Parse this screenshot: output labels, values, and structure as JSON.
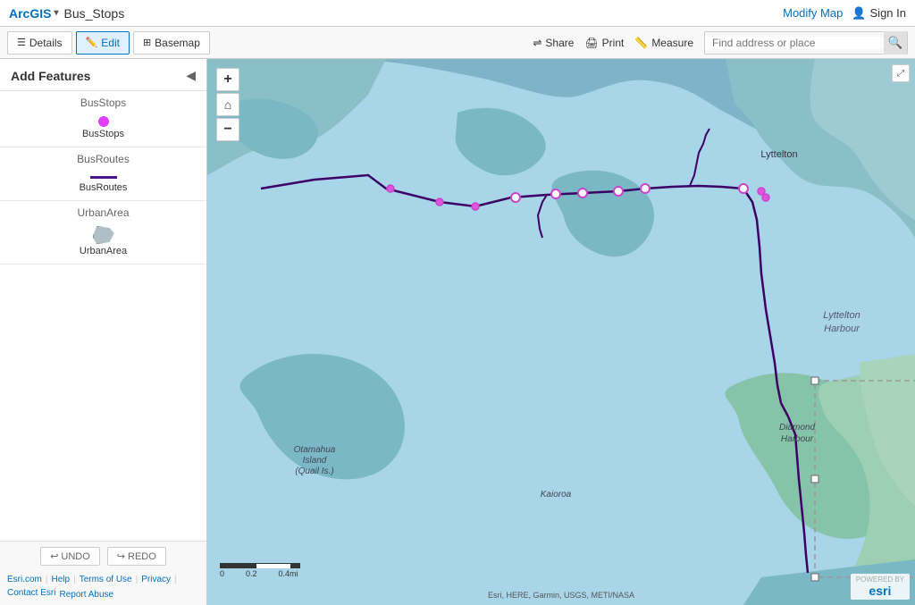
{
  "app": {
    "name": "ArcGIS",
    "map_title": "Bus_Stops"
  },
  "topbar": {
    "modify_map": "Modify Map",
    "sign_in": "Sign In"
  },
  "toolbar": {
    "details_label": "Details",
    "edit_label": "Edit",
    "basemap_label": "Basemap",
    "share_label": "Share",
    "print_label": "Print",
    "measure_label": "Measure",
    "search_placeholder": "Find address or place"
  },
  "sidebar": {
    "title": "Add Features",
    "groups": [
      {
        "label": "BusStops",
        "icon": "dot",
        "item_label": "BusStops"
      },
      {
        "label": "BusRoutes",
        "icon": "line",
        "item_label": "BusRoutes"
      },
      {
        "label": "UrbanArea",
        "icon": "polygon",
        "item_label": "UrbanArea"
      }
    ],
    "undo_label": "UNDO",
    "redo_label": "REDO"
  },
  "footer": {
    "links": [
      "Esri.com",
      "Help",
      "Terms of Use",
      "Privacy",
      "Contact Esri",
      "Report Abuse"
    ]
  },
  "map": {
    "zoom_in": "+",
    "zoom_out": "−",
    "home": "⌂",
    "scale_labels": [
      "0",
      "0.2",
      "0.4mi"
    ],
    "attribution": "Esri, HERE, Garmin, USGS, METI/NASA",
    "powered_by": "POWERED BY",
    "esri": "esri",
    "location_label": "Lyttelton Harbour",
    "location2": "Diamond Harbour",
    "location3": "Otamahua Island (Quail Is.)",
    "location4": "Kaioroa"
  }
}
